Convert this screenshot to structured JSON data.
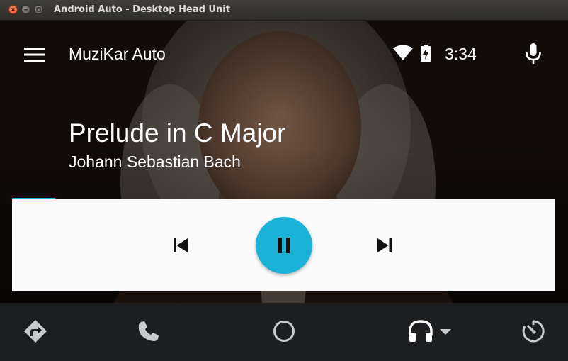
{
  "window": {
    "title": "Android Auto - Desktop Head Unit"
  },
  "status": {
    "app_name": "MuziKar Auto",
    "time": "3:34"
  },
  "now_playing": {
    "title": "Prelude in C Major",
    "artist": "Johann Sebastian Bach",
    "progress": 0.08,
    "state": "playing"
  },
  "icons": {
    "menu": "menu-icon",
    "wifi": "wifi-icon",
    "battery": "battery-charging-icon",
    "mic": "microphone-icon",
    "prev": "skip-previous-icon",
    "pause": "pause-icon",
    "next": "skip-next-icon",
    "nav": "navigation-icon",
    "phone": "phone-icon",
    "home": "home-circle-icon",
    "media": "headphones-icon",
    "media_menu": "dropdown-arrow-icon",
    "overview": "speedometer-icon"
  },
  "colors": {
    "accent": "#1bb2d8",
    "navbar": "#1d1e20",
    "controls_bg": "#fafafa",
    "nav_icon": "#c8cacc"
  }
}
